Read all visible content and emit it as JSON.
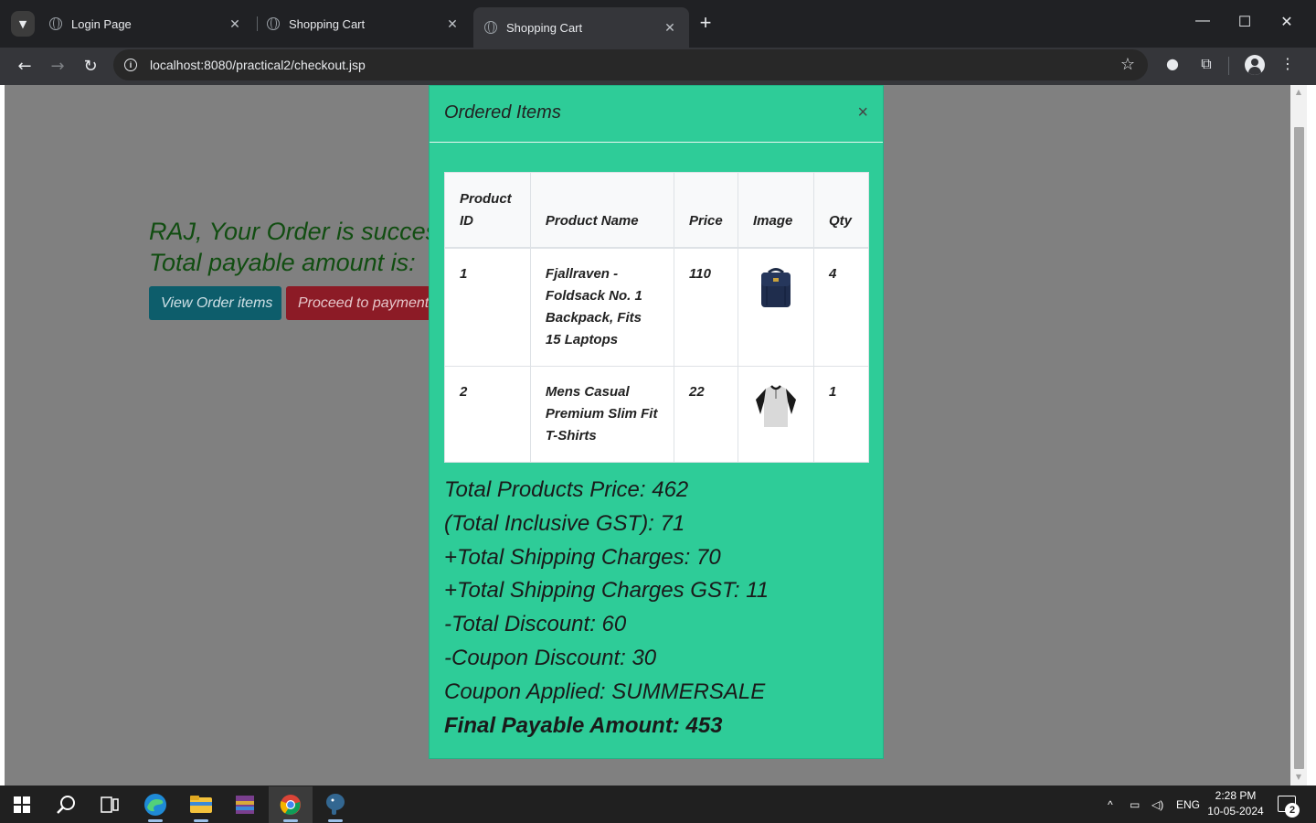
{
  "browser": {
    "tabs": [
      {
        "title": "Login Page",
        "active": false
      },
      {
        "title": "Shopping Cart",
        "active": false
      },
      {
        "title": "Shopping Cart",
        "active": true
      }
    ],
    "new_tab_glyph": "+",
    "url": "localhost:8080/practical2/checkout.jsp",
    "icons": [
      "tab-search-icon",
      "globe-icon",
      "close-icon",
      "back-icon",
      "forward-icon",
      "reload-icon",
      "info-icon",
      "star-icon",
      "extension-icon",
      "puzzle-icon",
      "profile-icon",
      "kebab-menu-icon",
      "minimize-icon",
      "maximize-icon",
      "window-close-icon"
    ]
  },
  "page": {
    "message_line1": "RAJ, Your Order is succes",
    "message_line2": "Total payable amount is:",
    "view_order_button": "View Order items",
    "payment_button": "Proceed to payment",
    "message_color": "#114d11"
  },
  "modal": {
    "title": "Ordered Items",
    "close_glyph": "×",
    "background_color": "#2ecc98",
    "table": {
      "headers": [
        "Product ID",
        "Product Name",
        "Price",
        "Image",
        "Qty"
      ],
      "rows": [
        {
          "id": "1",
          "name": "Fjallraven - Foldsack No. 1 Backpack, Fits 15 Laptops",
          "price": "110",
          "image": "backpack-image",
          "qty": "4"
        },
        {
          "id": "2",
          "name": "Mens Casual Premium Slim Fit T-Shirts",
          "price": "22",
          "image": "tshirt-image",
          "qty": "1"
        }
      ]
    },
    "totals": {
      "products_price": "Total Products Price: 462",
      "gst": "(Total Inclusive GST): 71",
      "shipping": "+Total Shipping Charges: 70",
      "shipping_gst": "+Total Shipping Charges GST: 11",
      "discount": "-Total Discount: 60",
      "coupon_discount": "-Coupon Discount: 30",
      "coupon_applied": "Coupon Applied: SUMMERSALE",
      "final": "Final Payable Amount: 453"
    }
  },
  "taskbar": {
    "apps": [
      "windows-start-icon",
      "search-icon",
      "task-view-icon",
      "edge-icon",
      "file-explorer-icon",
      "winrar-icon",
      "chrome-icon",
      "postgresql-icon"
    ],
    "language": "ENG",
    "time": "2:28 PM",
    "date": "10-05-2024",
    "notification_count": "2"
  }
}
